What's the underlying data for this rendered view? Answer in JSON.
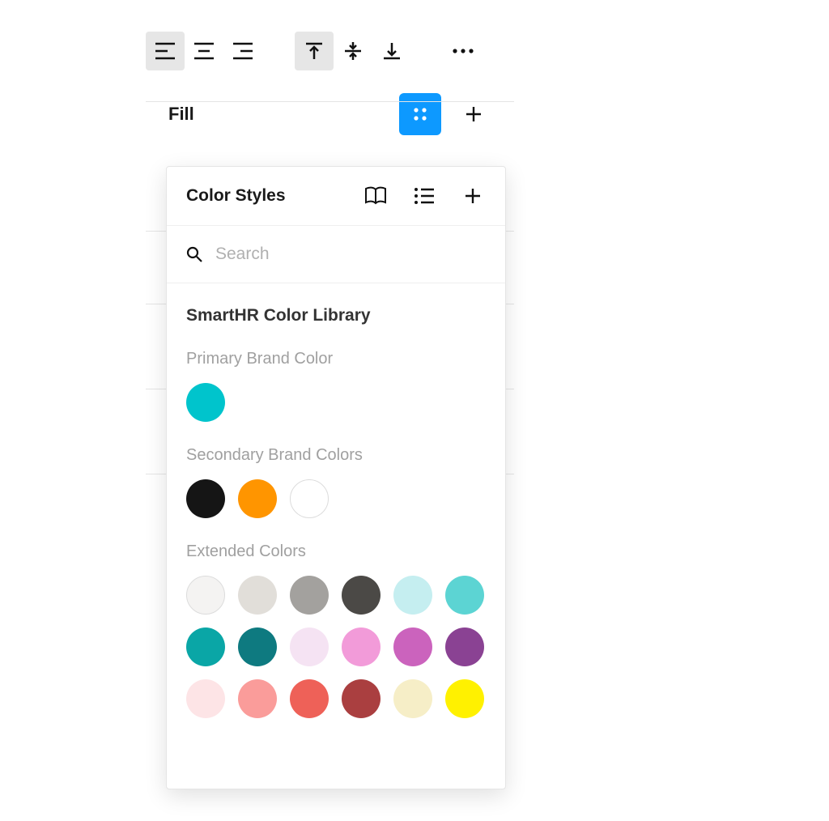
{
  "toolbar": {
    "text_align": [
      {
        "name": "text-align-left",
        "active": true
      },
      {
        "name": "text-align-center",
        "active": false
      },
      {
        "name": "text-align-right",
        "active": false
      }
    ],
    "vertical_align": [
      {
        "name": "vertical-align-top",
        "active": true
      },
      {
        "name": "vertical-align-middle",
        "active": false
      },
      {
        "name": "vertical-align-bottom",
        "active": false
      }
    ]
  },
  "fill": {
    "label": "Fill"
  },
  "popover": {
    "title": "Color Styles",
    "search_placeholder": "Search",
    "library_title": "SmartHR Color Library",
    "groups": [
      {
        "label": "Primary Brand Color",
        "swatches": [
          {
            "hex": "#00c4cc",
            "name": "primary-teal",
            "border": false
          }
        ]
      },
      {
        "label": "Secondary Brand Colors",
        "swatches": [
          {
            "hex": "#151515",
            "name": "black",
            "border": false
          },
          {
            "hex": "#ff9500",
            "name": "orange",
            "border": false
          },
          {
            "hex": "#ffffff",
            "name": "white",
            "border": true
          }
        ]
      },
      {
        "label": "Extended Colors",
        "swatches": [
          {
            "hex": "#f4f3f2",
            "name": "grey-05",
            "border": true
          },
          {
            "hex": "#e1ded9",
            "name": "grey-10",
            "border": false
          },
          {
            "hex": "#a3a19e",
            "name": "grey-40",
            "border": false
          },
          {
            "hex": "#4b4946",
            "name": "grey-80",
            "border": false
          },
          {
            "hex": "#c5eef0",
            "name": "teal-20",
            "border": false
          },
          {
            "hex": "#5cd4d3",
            "name": "teal-40",
            "border": false
          },
          {
            "hex": "#0aa6a6",
            "name": "teal-60",
            "border": false
          },
          {
            "hex": "#0e7a80",
            "name": "teal-80",
            "border": false
          },
          {
            "hex": "#f5e3f3",
            "name": "pink-10",
            "border": false
          },
          {
            "hex": "#f29bd9",
            "name": "pink-40",
            "border": false
          },
          {
            "hex": "#cb63bd",
            "name": "magenta-60",
            "border": false
          },
          {
            "hex": "#8a4293",
            "name": "purple-80",
            "border": false
          },
          {
            "hex": "#fde4e6",
            "name": "red-10",
            "border": false
          },
          {
            "hex": "#fa9c9a",
            "name": "red-30",
            "border": false
          },
          {
            "hex": "#ee6158",
            "name": "red-50",
            "border": false
          },
          {
            "hex": "#aa3f40",
            "name": "red-80",
            "border": false
          },
          {
            "hex": "#f6eec7",
            "name": "yellow-20",
            "border": false
          },
          {
            "hex": "#fff100",
            "name": "yellow-60",
            "border": false
          }
        ]
      }
    ]
  }
}
